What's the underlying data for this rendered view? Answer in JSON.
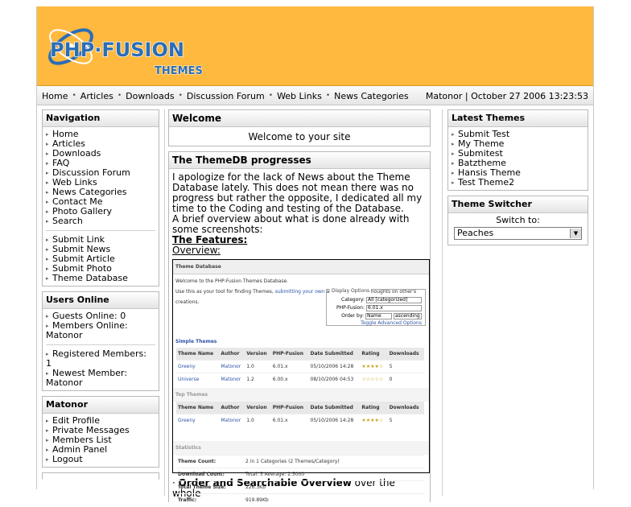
{
  "logo": {
    "line1": "PHP·FUSION",
    "line2": "THEMES"
  },
  "topnav": {
    "links": [
      "Home",
      "Articles",
      "Downloads",
      "Discussion Forum",
      "Web Links",
      "News Categories"
    ],
    "user_date": "Matonor | October 27 2006 13:23:53"
  },
  "navigation": {
    "title": "Navigation",
    "group1": [
      "Home",
      "Articles",
      "Downloads",
      "FAQ",
      "Discussion Forum",
      "Web Links",
      "News Categories",
      "Contact Me",
      "Photo Gallery",
      "Search"
    ],
    "group2": [
      "Submit Link",
      "Submit News",
      "Submit Article",
      "Submit Photo",
      "Theme Database"
    ]
  },
  "users_online": {
    "title": "Users Online",
    "guests": "Guests Online: 0",
    "members_online": "Members Online:",
    "members_online_name": "Matonor",
    "registered": "Registered Members:",
    "registered_count": "1",
    "newest": "Newest Member:",
    "newest_name": "Matonor"
  },
  "user_panel": {
    "title": "Matonor",
    "items": [
      "Edit Profile",
      "Private Messages",
      "Members List",
      "Admin Panel",
      "Logout"
    ]
  },
  "welcome": {
    "title": "Welcome",
    "text": "Welcome to your site"
  },
  "article": {
    "title": "The ThemeDB progresses",
    "p1": "I apologize for the lack of News about the Theme Database lately. This does not mean there was no progress but rather the opposite, I dedicated all my time to the Coding and testing of the Database.",
    "p2": "A brief overview about what is done already with some screenshots:",
    "features": "The Features:",
    "overview": "Overview:",
    "bottom_bold": "Order and Searchable Overview",
    "bottom_rest": " over the whole"
  },
  "screenshot": {
    "title": "Theme Database",
    "intro1": "Welcome to the PHP-Fusion Themes Database.",
    "intro2a": "Use this as your tool for finding Themes, ",
    "intro2link": "submitting your own",
    "intro2b": " and sharing your thoughts on other's creations.",
    "options_title": "Display Options",
    "opt_category_label": "Category:",
    "opt_category_value": "All [categorized]",
    "opt_fusion_label": "PHP-Fusion:",
    "opt_fusion_value": "6.01.x",
    "opt_order_label": "Order by:",
    "opt_order_value": "Name",
    "opt_dir_value": "ascending",
    "advanced": "Toggle Advanced Options",
    "simple_title": "Simple Themes",
    "top_title": "Top Themes",
    "headers": [
      "Theme Name",
      "Author",
      "Version",
      "PHP-Fusion",
      "Date Submitted",
      "Rating",
      "Downloads"
    ],
    "simple_rows": [
      [
        "Greeny",
        "Matonor",
        "1.0",
        "6.01.x",
        "05/10/2006 14:28",
        "★★★★☆",
        "5"
      ],
      [
        "Universe",
        "Matonor",
        "1.2",
        "6.00.x",
        "08/10/2006 04:53",
        "☆☆☆☆☆",
        "0"
      ]
    ],
    "top_rows": [
      [
        "Greeny",
        "Matonor",
        "1.0",
        "6.01.x",
        "05/10/2006 14:28",
        "★★★★☆",
        "5"
      ]
    ],
    "stats_title": "Statistics",
    "stats": [
      [
        "Theme Count:",
        "2 in 1 Categories (2 Themes/Category)"
      ],
      [
        "Download Count:",
        "Total: 5 Average: 2.5000"
      ],
      [
        "Total Theme Size:",
        "226.3Kb"
      ],
      [
        "Traffic:",
        "919.89Kb"
      ]
    ]
  },
  "latest_themes": {
    "title": "Latest Themes",
    "items": [
      "Submit Test",
      "My Theme",
      "Submitest",
      "Batztheme",
      "Hansis Theme",
      "Test Theme2"
    ]
  },
  "theme_switcher": {
    "title": "Theme Switcher",
    "label": "Switch to:",
    "selected": "Peaches"
  },
  "colors": {
    "header_bg": "#ffb93f",
    "link_blue": "#2d55a7"
  }
}
